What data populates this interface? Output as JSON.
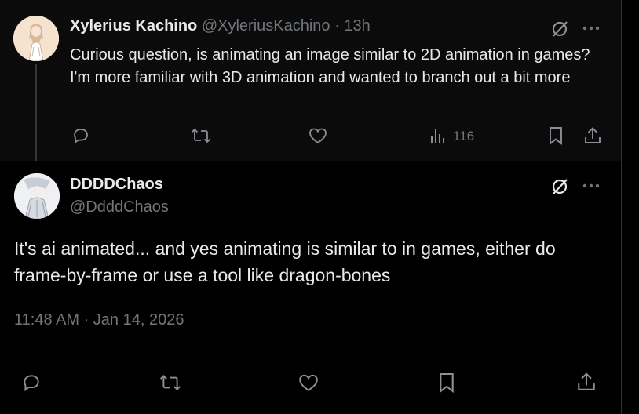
{
  "parent_tweet": {
    "author_name": "Xylerius Kachino",
    "author_handle": "@XyleriusKachino",
    "separator": "·",
    "time": "13h",
    "text": "Curious question, is animating an image similar to 2D animation in games? I'm more familiar with 3D animation and wanted to branch out a bit more",
    "views": "116",
    "icons": [
      "grok-icon",
      "more-icon",
      "reply-icon",
      "retweet-icon",
      "like-icon",
      "views-icon",
      "bookmark-icon",
      "share-icon"
    ]
  },
  "reply_tweet": {
    "author_name": "DDDDChaos",
    "author_handle": "@DdddChaos",
    "text": "It's ai animated... and yes animating is similar to in games, either do frame-by-frame or use a tool like dragon-bones",
    "timestamp": "11:48 AM · Jan 14, 2026",
    "icons": [
      "grok-icon",
      "more-icon",
      "reply-icon",
      "retweet-icon",
      "like-icon",
      "bookmark-icon",
      "share-icon"
    ]
  },
  "colors": {
    "background": "#000000",
    "parent_background": "#0b0b0b",
    "text_primary": "#e7e9ea",
    "text_secondary": "#71767b",
    "border": "#2f3336"
  }
}
